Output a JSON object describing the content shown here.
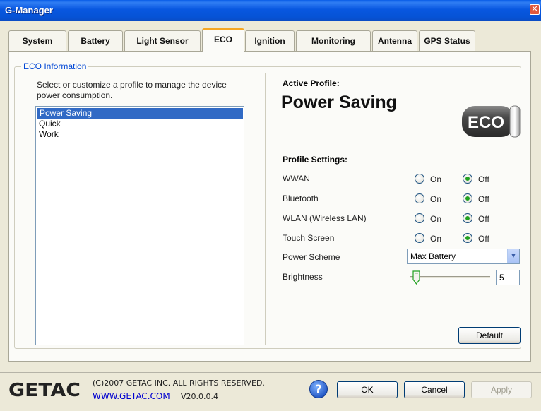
{
  "window": {
    "title": "G-Manager",
    "close_glyph": "✕"
  },
  "tabs": [
    {
      "label": "System"
    },
    {
      "label": "Battery"
    },
    {
      "label": "Light Sensor"
    },
    {
      "label": "ECO",
      "active": true
    },
    {
      "label": "Ignition"
    },
    {
      "label": "Monitoring"
    },
    {
      "label": "Antenna"
    },
    {
      "label": "GPS Status"
    }
  ],
  "eco": {
    "group_title": "ECO Information",
    "description": "Select or customize a profile to manage the device power consumption.",
    "profiles": [
      "Power Saving",
      "Quick",
      "Work"
    ],
    "selected_profile": "Power Saving",
    "active_profile_label": "Active Profile:",
    "active_profile_name": "Power Saving",
    "badge_text": "ECO",
    "profile_settings_label": "Profile Settings:",
    "settings": [
      {
        "label": "WWAN",
        "on_label": "On",
        "off_label": "Off",
        "value": "Off"
      },
      {
        "label": "Bluetooth",
        "on_label": "On",
        "off_label": "Off",
        "value": "Off"
      },
      {
        "label": "WLAN (Wireless LAN)",
        "on_label": "On",
        "off_label": "Off",
        "value": "Off"
      },
      {
        "label": "Touch Screen",
        "on_label": "On",
        "off_label": "Off",
        "value": "Off"
      }
    ],
    "power_scheme_label": "Power Scheme",
    "power_scheme_value": "Max Battery",
    "brightness_label": "Brightness",
    "brightness_value": "5",
    "default_button": "Default"
  },
  "footer": {
    "logo_text": "GETAC",
    "copyright": "(C)2007 GETAC INC. ALL RIGHTS RESERVED.",
    "website": "WWW.GETAC.COM",
    "version": "V20.0.0.4",
    "ok_button": "OK",
    "cancel_button": "Cancel",
    "apply_button": "Apply"
  },
  "colors": {
    "titlebar": "#0857e0",
    "selection": "#316ac5",
    "active_tab_accent": "#f5a623",
    "radio_checked": "#21a121",
    "link": "#0000d0"
  }
}
